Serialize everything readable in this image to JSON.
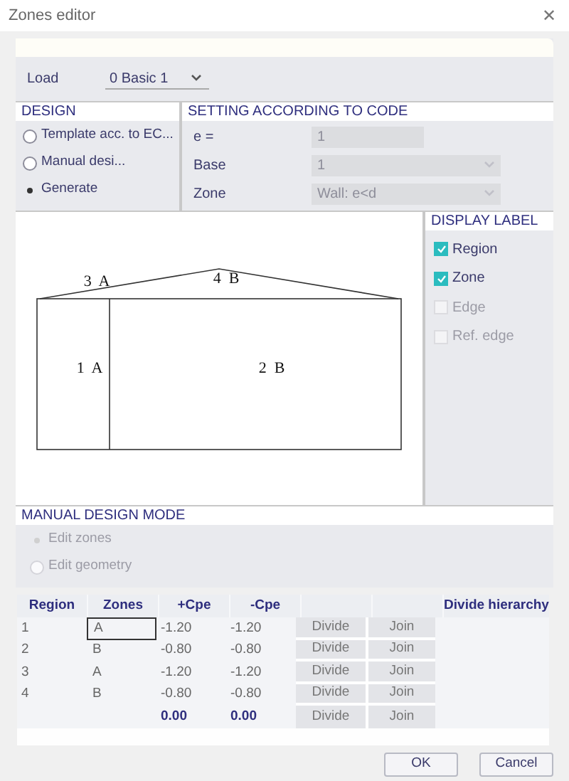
{
  "window": {
    "title": "Zones editor",
    "close": "✕"
  },
  "load": {
    "label": "Load",
    "value": "0 Basic 1"
  },
  "design": {
    "title": "DESIGN",
    "options": [
      {
        "label": "Template acc. to EC...",
        "selected": false
      },
      {
        "label": "Manual desi...",
        "selected": false
      },
      {
        "label": "Generate",
        "selected": true
      }
    ]
  },
  "code_settings": {
    "title": "SETTING ACCORDING TO CODE",
    "fields": [
      {
        "kind": "text",
        "label": "e =",
        "value": "1"
      },
      {
        "kind": "select",
        "label": "Base",
        "value": "1"
      },
      {
        "kind": "select",
        "label": "Zone",
        "value": "Wall: e<d"
      }
    ]
  },
  "diagram": {
    "labels": [
      "3  A",
      "4  B",
      "1  A",
      "2  B"
    ]
  },
  "display_label": {
    "title": "DISPLAY LABEL",
    "options": [
      {
        "label": "Region",
        "checked": true,
        "disabled": false
      },
      {
        "label": "Zone",
        "checked": true,
        "disabled": false
      },
      {
        "label": "Edge",
        "checked": false,
        "disabled": true
      },
      {
        "label": "Ref. edge",
        "checked": false,
        "disabled": true
      }
    ]
  },
  "manual_design_mode": {
    "title": "MANUAL DESIGN MODE",
    "options": [
      {
        "label": "Edit zones",
        "selected": true,
        "disabled": true
      },
      {
        "label": "Edit geometry",
        "selected": false,
        "disabled": true
      }
    ]
  },
  "table": {
    "columns": [
      "Region",
      "Zones",
      "+Cpe",
      "-Cpe",
      "Divide hierarchy"
    ],
    "rows": [
      {
        "region": "1",
        "zone": "A",
        "plus": "-1.20",
        "minus": "-1.20",
        "divide": "Divide",
        "join": "Join",
        "selected": true
      },
      {
        "region": "2",
        "zone": "B",
        "plus": "-0.80",
        "minus": "-0.80",
        "divide": "Divide",
        "join": "Join",
        "selected": false
      },
      {
        "region": "3",
        "zone": "A",
        "plus": "-1.20",
        "minus": "-1.20",
        "divide": "Divide",
        "join": "Join",
        "selected": false
      },
      {
        "region": "4",
        "zone": "B",
        "plus": "-0.80",
        "minus": "-0.80",
        "divide": "Divide",
        "join": "Join",
        "selected": false
      }
    ],
    "totals": {
      "plus": "0.00",
      "minus": "0.00",
      "divide": "Divide",
      "join": "Join"
    }
  },
  "buttons": [
    "OK",
    "Cancel"
  ]
}
